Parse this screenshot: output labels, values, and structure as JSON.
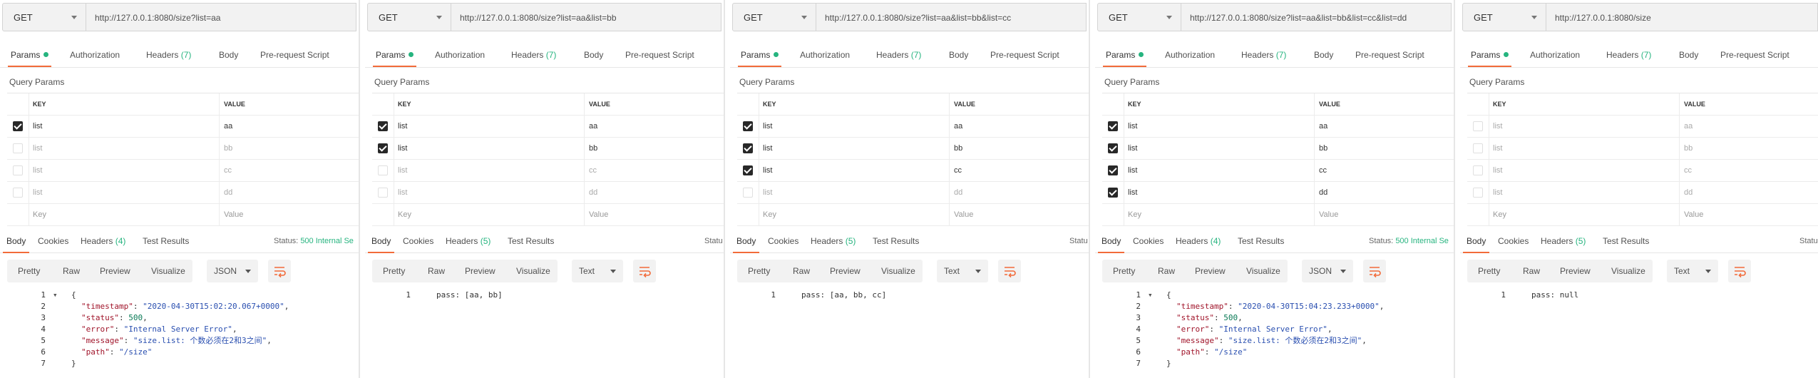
{
  "request_tabs": {
    "params": "Params",
    "authorization": "Authorization",
    "headers": "Headers",
    "headers_count": "(7)",
    "body": "Body",
    "prerequest": "Pre-request Script"
  },
  "query_params_title": "Query Params",
  "table_headers": {
    "key": "KEY",
    "value": "VALUE"
  },
  "placeholders": {
    "key": "Key",
    "value": "Value"
  },
  "response_tabs": {
    "body": "Body",
    "cookies": "Cookies",
    "headers": "Headers",
    "test_results": "Test Results"
  },
  "view_buttons": {
    "pretty": "Pretty",
    "raw": "Raw",
    "preview": "Preview",
    "visualize": "Visualize"
  },
  "colors": {
    "accent": "#f26b3a",
    "green": "#26b47f"
  },
  "icons": {
    "wrap": "wrap-lines-icon",
    "check": "checkbox-icon",
    "caret": "caret-down-icon"
  },
  "panels": [
    {
      "method": "GET",
      "url": "http://127.0.0.1:8080/size?list=aa",
      "params": [
        {
          "key": "list",
          "value": "aa",
          "checked": true
        },
        {
          "key": "list",
          "value": "bb",
          "checked": false
        },
        {
          "key": "list",
          "value": "cc",
          "checked": false
        },
        {
          "key": "list",
          "value": "dd",
          "checked": false
        }
      ],
      "response_headers_count": "(4)",
      "status_label": "Status:",
      "status_value": "500 Internal Se",
      "format": "JSON",
      "code": [
        {
          "ln": "1",
          "text": "{",
          "type": "brace"
        },
        {
          "ln": "2",
          "key": "\"timestamp\"",
          "val": "\"2020-04-30T15:02:20.067+0000\"",
          "vtype": "s",
          "comma": ","
        },
        {
          "ln": "3",
          "key": "\"status\"",
          "val": "500",
          "vtype": "n",
          "comma": ","
        },
        {
          "ln": "4",
          "key": "\"error\"",
          "val": "\"Internal Server Error\"",
          "vtype": "s",
          "comma": ","
        },
        {
          "ln": "5",
          "key": "\"message\"",
          "val": "\"size.list: 个数必须在2和3之间\"",
          "vtype": "s",
          "comma": ","
        },
        {
          "ln": "6",
          "key": "\"path\"",
          "val": "\"/size\"",
          "vtype": "s",
          "comma": ""
        },
        {
          "ln": "7",
          "text": "}",
          "type": "brace"
        }
      ]
    },
    {
      "method": "GET",
      "url": "http://127.0.0.1:8080/size?list=aa&list=bb",
      "params": [
        {
          "key": "list",
          "value": "aa",
          "checked": true
        },
        {
          "key": "list",
          "value": "bb",
          "checked": true
        },
        {
          "key": "list",
          "value": "cc",
          "checked": false
        },
        {
          "key": "list",
          "value": "dd",
          "checked": false
        }
      ],
      "response_headers_count": "(5)",
      "status_label": "Statu",
      "status_value": "",
      "format": "Text",
      "code": [
        {
          "ln": "1",
          "text": "pass: [aa, bb]",
          "type": "plain"
        }
      ]
    },
    {
      "method": "GET",
      "url": "http://127.0.0.1:8080/size?list=aa&list=bb&list=cc",
      "params": [
        {
          "key": "list",
          "value": "aa",
          "checked": true
        },
        {
          "key": "list",
          "value": "bb",
          "checked": true
        },
        {
          "key": "list",
          "value": "cc",
          "checked": true
        },
        {
          "key": "list",
          "value": "dd",
          "checked": false
        }
      ],
      "response_headers_count": "(5)",
      "status_label": "Statu",
      "status_value": "",
      "format": "Text",
      "code": [
        {
          "ln": "1",
          "text": "pass: [aa, bb, cc]",
          "type": "plain"
        }
      ]
    },
    {
      "method": "GET",
      "url": "http://127.0.0.1:8080/size?list=aa&list=bb&list=cc&list=dd",
      "params": [
        {
          "key": "list",
          "value": "aa",
          "checked": true
        },
        {
          "key": "list",
          "value": "bb",
          "checked": true
        },
        {
          "key": "list",
          "value": "cc",
          "checked": true
        },
        {
          "key": "list",
          "value": "dd",
          "checked": true
        }
      ],
      "response_headers_count": "(4)",
      "status_label": "Status:",
      "status_value": "500 Internal Se",
      "format": "JSON",
      "code": [
        {
          "ln": "1",
          "text": "{",
          "type": "brace"
        },
        {
          "ln": "2",
          "key": "\"timestamp\"",
          "val": "\"2020-04-30T15:04:23.233+0000\"",
          "vtype": "s",
          "comma": ","
        },
        {
          "ln": "3",
          "key": "\"status\"",
          "val": "500",
          "vtype": "n",
          "comma": ","
        },
        {
          "ln": "4",
          "key": "\"error\"",
          "val": "\"Internal Server Error\"",
          "vtype": "s",
          "comma": ","
        },
        {
          "ln": "5",
          "key": "\"message\"",
          "val": "\"size.list: 个数必须在2和3之间\"",
          "vtype": "s",
          "comma": ","
        },
        {
          "ln": "6",
          "key": "\"path\"",
          "val": "\"/size\"",
          "vtype": "s",
          "comma": ""
        },
        {
          "ln": "7",
          "text": "}",
          "type": "brace"
        }
      ]
    },
    {
      "method": "GET",
      "url": "http://127.0.0.1:8080/size",
      "params": [
        {
          "key": "list",
          "value": "aa",
          "checked": false
        },
        {
          "key": "list",
          "value": "bb",
          "checked": false
        },
        {
          "key": "list",
          "value": "cc",
          "checked": false
        },
        {
          "key": "list",
          "value": "dd",
          "checked": false
        }
      ],
      "response_headers_count": "(5)",
      "status_label": "Statu",
      "status_value": "",
      "format": "Text",
      "code": [
        {
          "ln": "1",
          "text": "pass: null",
          "type": "plain"
        }
      ]
    }
  ]
}
